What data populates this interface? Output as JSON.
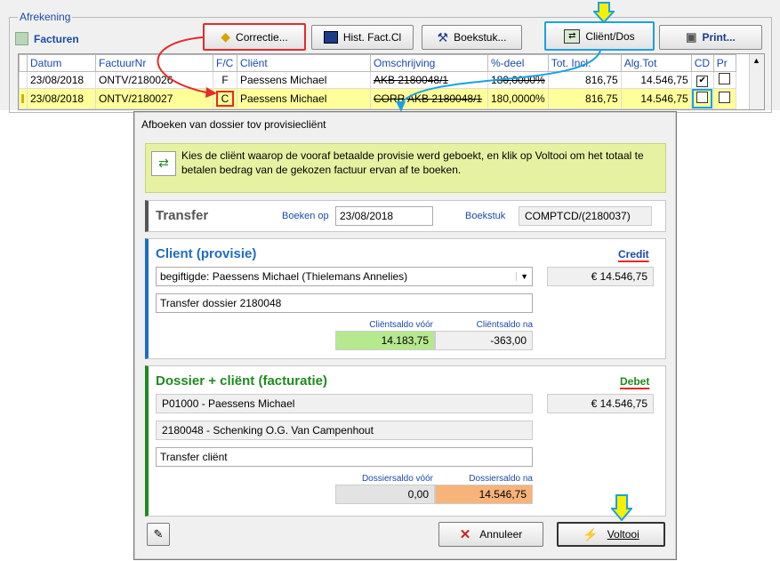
{
  "bg": {
    "group_title": "Afrekening",
    "facturen_label": "Facturen",
    "buttons": {
      "correctie": "Correctie...",
      "hist": "Hist. Fact.Cl",
      "boekstuk": "Boekstuk...",
      "client_dos": "Cliënt/Dos",
      "print": "Print..."
    },
    "columns": [
      "Datum",
      "FactuurNr",
      "F/C",
      "Cliënt",
      "Omschrijving",
      "%-deel",
      "Tot. Incl.",
      "Alg.Tot",
      "CD",
      "Pr"
    ],
    "rows": [
      {
        "datum": "23/08/2018",
        "factuur": "ONTV/2180026",
        "fc": "F",
        "client": "Paessens Michael",
        "omschrijving": "AKB 2180048/1",
        "pct": "180,0000%",
        "tot": "816,75",
        "alg": "14.546,75",
        "cd": "✔",
        "pr": ""
      },
      {
        "datum": "23/08/2018",
        "factuur": "ONTV/2180027",
        "fc": "C",
        "client": "Paessens Michael",
        "omschrijving": "CORR AKB 2180048/1",
        "pct": "180,0000%",
        "tot": "816,75",
        "alg": "14.546,75",
        "cd": "",
        "pr": ""
      }
    ]
  },
  "dialog": {
    "title": "Afboeken van dossier tov provisiecliënt",
    "info": "Kies de cliënt waarop de vooraf betaalde provisie werd geboekt, en klik op Voltooi om het totaal te betalen bedrag van de gekozen factuur ervan af te boeken.",
    "transfer": {
      "title": "Transfer",
      "boeken_op_label": "Boeken op",
      "boeken_op_value": "23/08/2018",
      "boekstuk_label": "Boekstuk",
      "boekstuk_value": "COMPTCD/(2180037)"
    },
    "client": {
      "title": "Client (provisie)",
      "side": "Credit",
      "select_value": "begiftigde: Paessens Michael (Thielemans Annelies)",
      "amount": "€ 14.546,75",
      "description": "Transfer dossier 2180048",
      "saldo_voor_label": "Cliëntsaldo vóór",
      "saldo_voor": "14.183,75",
      "saldo_na_label": "Cliëntsaldo na",
      "saldo_na": "-363,00"
    },
    "dossier": {
      "title": "Dossier + cliënt (facturatie)",
      "side": "Debet",
      "client_value": "P01000 - Paessens Michael",
      "amount": "€ 14.546,75",
      "dossier_value": "2180048 - Schenking O.G. Van Campenhout",
      "description": "Transfer cliënt",
      "saldo_voor_label": "Dossiersaldo vóór",
      "saldo_voor": "0,00",
      "saldo_na_label": "Dossiersaldo na",
      "saldo_na": "14.546,75"
    },
    "buttons": {
      "annuleer": "Annuleer",
      "voltooi": "Voltooi"
    }
  }
}
